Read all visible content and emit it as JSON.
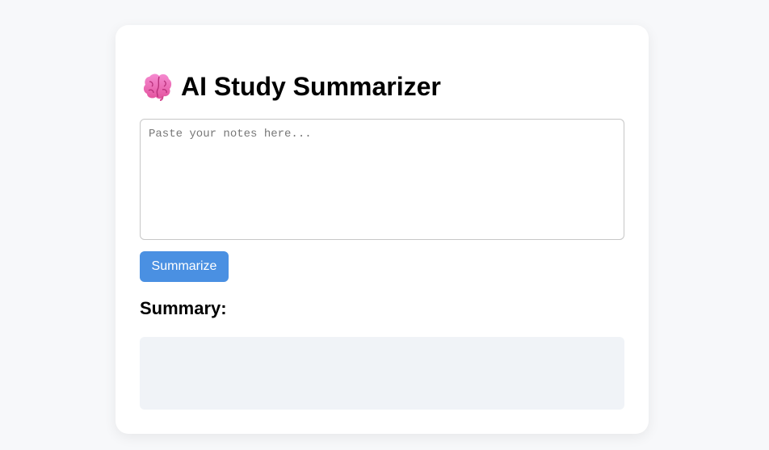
{
  "app": {
    "title": "AI Study Summarizer",
    "title_icon": "brain-icon"
  },
  "notes_input": {
    "value": "",
    "placeholder": "Paste your notes here..."
  },
  "actions": {
    "summarize_label": "Summarize"
  },
  "summary": {
    "heading": "Summary:",
    "text": ""
  },
  "colors": {
    "page_background": "#f7f8fa",
    "card_background": "#ffffff",
    "accent": "#4a90e2",
    "summary_background": "#f0f3f7"
  }
}
